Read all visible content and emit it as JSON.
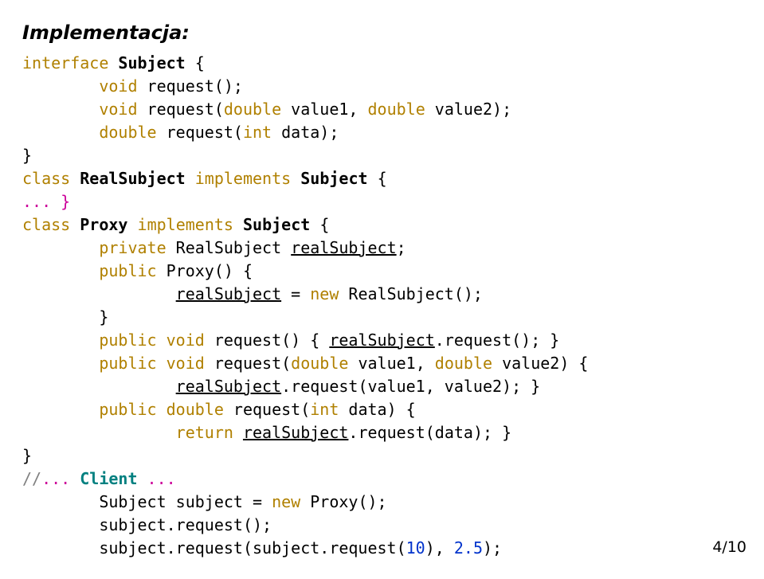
{
  "heading": "Implementacja:",
  "code": {
    "l1a": "interface",
    "l1b": "Subject",
    "l1c": " {",
    "l2a": "void",
    "l2b": " request();",
    "l3a": "void",
    "l3b": " request(",
    "l3c": "double",
    "l3d": " value1, ",
    "l3e": "double",
    "l3f": " value2);",
    "l4a": "double",
    "l4b": " request(",
    "l4c": "int",
    "l4d": " data);",
    "l5": "}",
    "l6a": "class",
    "l6b": "RealSubject",
    "l6c": "implements",
    "l6d": "Subject",
    "l6e": " {",
    "l7": "... }",
    "l8a": "class",
    "l8b": "Proxy",
    "l8c": "implements",
    "l8d": "Subject",
    "l8e": " {",
    "l9a": "private",
    "l9b": " RealSubject ",
    "l9c": "realSubject",
    "l9d": ";",
    "l10a": "public",
    "l10b": " Proxy() {",
    "l11a": "realSubject",
    "l11b": " = ",
    "l11c": "new",
    "l11d": " RealSubject();",
    "l12": "        }",
    "l13a": "public",
    "l13b": "void",
    "l13c": " request() { ",
    "l13d": "realSubject",
    "l13e": ".request(); }",
    "l14a": "public",
    "l14b": "void",
    "l14c": " request(",
    "l14d": "double",
    "l14e": " value1, ",
    "l14f": "double",
    "l14g": " value2) {",
    "l15a": "realSubject",
    "l15b": ".request(value1, value2); }",
    "l16a": "public",
    "l16b": "double",
    "l16c": " request(",
    "l16d": "int",
    "l16e": " data) {",
    "l17a": "return",
    "l17b": "realSubject",
    "l17c": ".request(data); }",
    "l18": "}",
    "l19a": "//",
    "l19b": "... ",
    "l19c": "Client",
    "l19d": " ...",
    "l20a": "        Subject subject = ",
    "l20b": "new",
    "l20c": " Proxy();",
    "l21": "        subject.request();",
    "l22a": "        subject.request(subject.request(",
    "l22b": "10",
    "l22c": "), ",
    "l22d": "2.5",
    "l22e": ");"
  },
  "page_num": "4/10"
}
